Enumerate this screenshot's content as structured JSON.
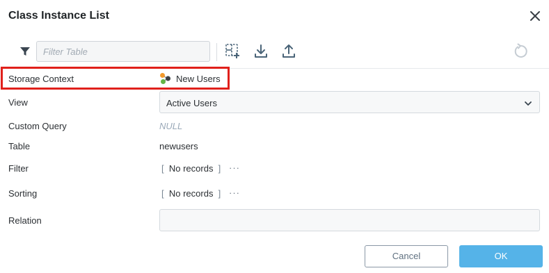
{
  "dialog": {
    "title": "Class Instance List"
  },
  "toolbar": {
    "filter_placeholder": "Filter Table",
    "icons": [
      "filter-icon",
      "select-columns-icon",
      "download-icon",
      "upload-icon",
      "refresh-icon"
    ]
  },
  "fields": {
    "storage_context": {
      "label": "Storage Context",
      "value": "New Users",
      "icon": "storage-context-icon"
    },
    "view": {
      "label": "View",
      "value": "Active Users"
    },
    "custom_query": {
      "label": "Custom Query",
      "value": "NULL"
    },
    "table": {
      "label": "Table",
      "value": "newusers"
    },
    "filter": {
      "label": "Filter",
      "open": "[",
      "value": "No records",
      "close": "]",
      "more": "···"
    },
    "sorting": {
      "label": "Sorting",
      "open": "[",
      "value": "No records",
      "close": "]",
      "more": "···"
    },
    "relation": {
      "label": "Relation",
      "value": ""
    }
  },
  "footer": {
    "cancel_label": "Cancel",
    "ok_label": "OK"
  },
  "colors": {
    "highlight": "#e0201b",
    "primary": "#55b3e8",
    "null_text": "#9aa9b8"
  }
}
